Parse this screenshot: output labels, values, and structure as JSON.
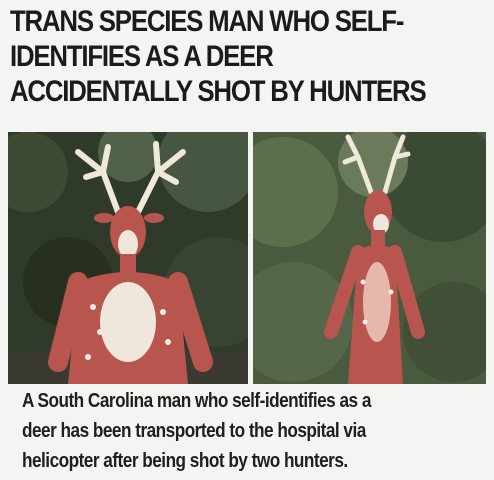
{
  "headline": {
    "lines": [
      "TRANS SPECIES MAN WHO SELF-",
      "IDENTIFIES AS A DEER",
      "ACCIDENTALLY SHOT BY HUNTERS"
    ]
  },
  "photos": [
    {
      "subject": "person-in-deer-costume-with-antlers"
    },
    {
      "subject": "person-in-deer-costume-with-antlers"
    }
  ],
  "caption": {
    "lines": [
      "A South Carolina man who self-identifies as a",
      "deer has been transported to the hospital via",
      "helicopter after being shot by two hunters."
    ]
  },
  "colors": {
    "background": "#f4f4f2",
    "text": "#1b1b1b",
    "foliage": "#2f3a2a",
    "costume": "#b8554f"
  }
}
